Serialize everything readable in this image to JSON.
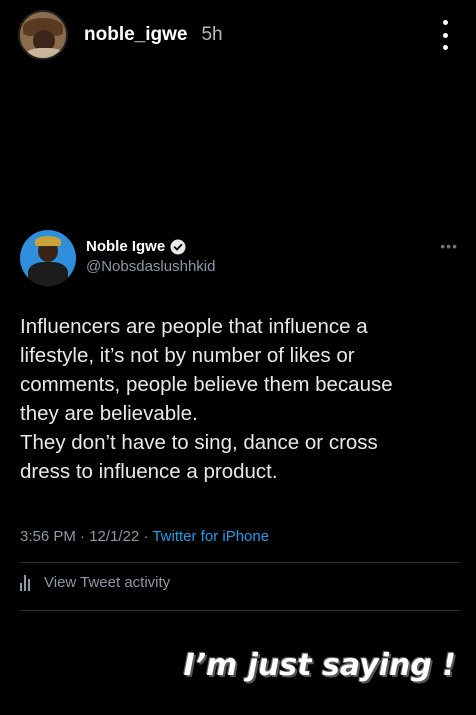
{
  "story": {
    "username": "noble_igwe",
    "time_ago": "5h",
    "more_icon": "vertical-dots-icon"
  },
  "tweet": {
    "name": "Noble Igwe",
    "verified_icon": "verified-badge-icon",
    "handle": "@Nobsdaslushhkid",
    "more_icon": "horizontal-dots-icon",
    "text_lines": [
      "Influencers are people that influence a",
      "lifestyle, it’s not by number of likes or",
      "comments, people believe them because",
      "they are believable.",
      "They don’t have to sing, dance or cross",
      "dress to influence a product."
    ],
    "time": "3:56 PM",
    "date": "12/1/22",
    "separator": "·",
    "source": "Twitter for iPhone",
    "activity_label": "View Tweet activity",
    "activity_icon": "bar-chart-icon"
  },
  "sticker": {
    "text": "I’m just saying !"
  },
  "colors": {
    "background": "#000000",
    "link": "#1d9bf0",
    "secondary_text": "#8b98a5",
    "verified": "#1d9bf0"
  }
}
